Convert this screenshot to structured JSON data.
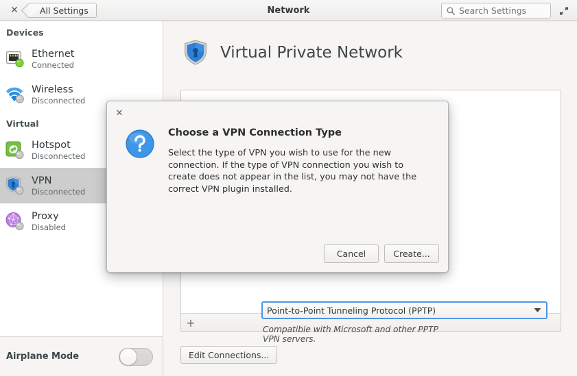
{
  "header": {
    "close_label": "✕",
    "back_label": "All Settings",
    "title": "Network",
    "search_placeholder": "Search Settings",
    "search_value": "",
    "search_icon": "search-icon",
    "maximize_icon": "maximize-icon"
  },
  "sidebar": {
    "groups": [
      {
        "label": "Devices",
        "items": [
          {
            "label": "Ethernet",
            "state": "Connected",
            "icon": "ethernet-icon",
            "selected": false
          },
          {
            "label": "Wireless",
            "state": "Disconnected",
            "icon": "wireless-icon",
            "selected": false
          }
        ]
      },
      {
        "label": "Virtual",
        "items": [
          {
            "label": "Hotspot",
            "state": "Disconnected",
            "icon": "hotspot-icon",
            "selected": false
          },
          {
            "label": "VPN",
            "state": "Disconnected",
            "icon": "vpn-shield-icon",
            "selected": true
          },
          {
            "label": "Proxy",
            "state": "Disabled",
            "icon": "proxy-globe-icon",
            "selected": false
          }
        ]
      }
    ],
    "airplane_mode": {
      "label": "Airplane Mode",
      "state": "off"
    }
  },
  "main": {
    "page_title": "Virtual Private Network",
    "page_icon": "vpn-shield-icon",
    "add_button_label": "+",
    "edit_connections_label": "Edit Connections...",
    "connections": []
  },
  "dialog": {
    "close_label": "✕",
    "icon": "question-mark-icon",
    "title": "Choose a VPN Connection Type",
    "description": "Select the type of VPN you wish to use for the new connection. If the type of VPN connection you wish to create does not appear in the list, you may not have the correct VPN plugin installed.",
    "combo": {
      "selected": "Point-to-Point Tunneling Protocol (PPTP)",
      "options": [
        "Point-to-Point Tunneling Protocol (PPTP)"
      ]
    },
    "hint": "Compatible with Microsoft and other PPTP VPN servers.",
    "cancel_label": "Cancel",
    "create_label": "Create..."
  },
  "colors": {
    "accent": "#5294e2",
    "connected": "#6dc13a",
    "disconnected": "#b5b5b5",
    "selection": "#cdcdcd"
  }
}
